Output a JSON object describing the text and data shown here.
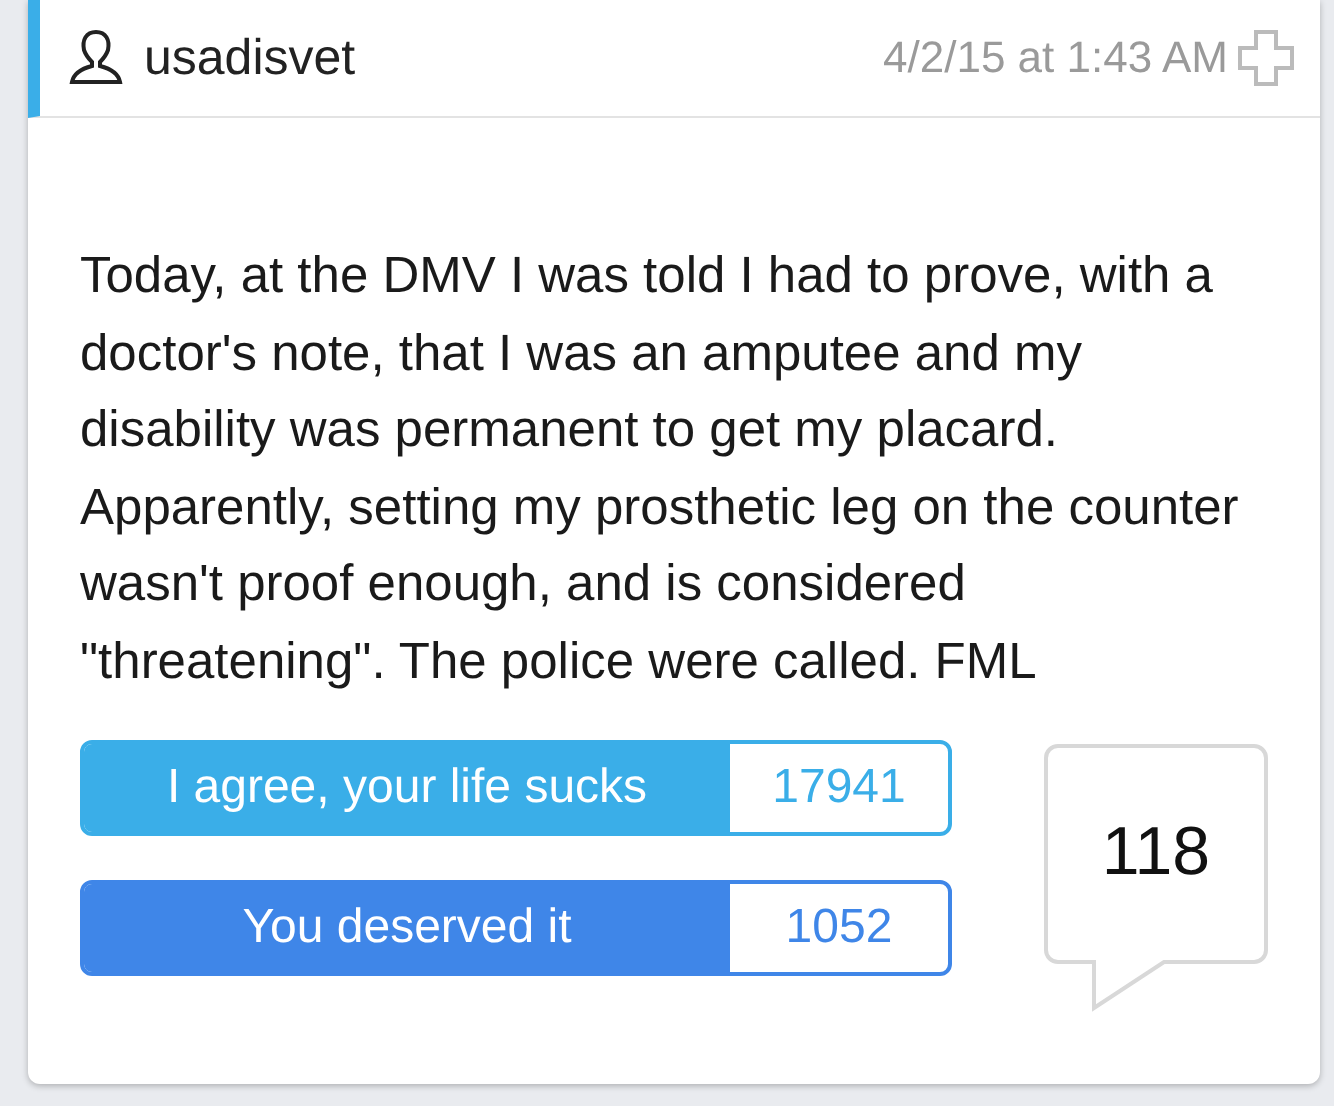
{
  "post": {
    "author": "usadisvet",
    "timestamp": "4/2/15 at 1:43 AM",
    "body": "Today, at the DMV I was told I had to prove, with a doctor's note, that I was an amputee and my disability was permanent to get my placard. Apparently, setting my prosthetic leg on the counter wasn't proof enough, and is considered \"threatening\". The police were called. FML",
    "votes": [
      {
        "label": "I agree, your life sucks",
        "count": "17941",
        "color": "#3aaee8"
      },
      {
        "label": "You deserved it",
        "count": "1052",
        "color": "#3f86e8"
      }
    ],
    "comments": "118"
  }
}
